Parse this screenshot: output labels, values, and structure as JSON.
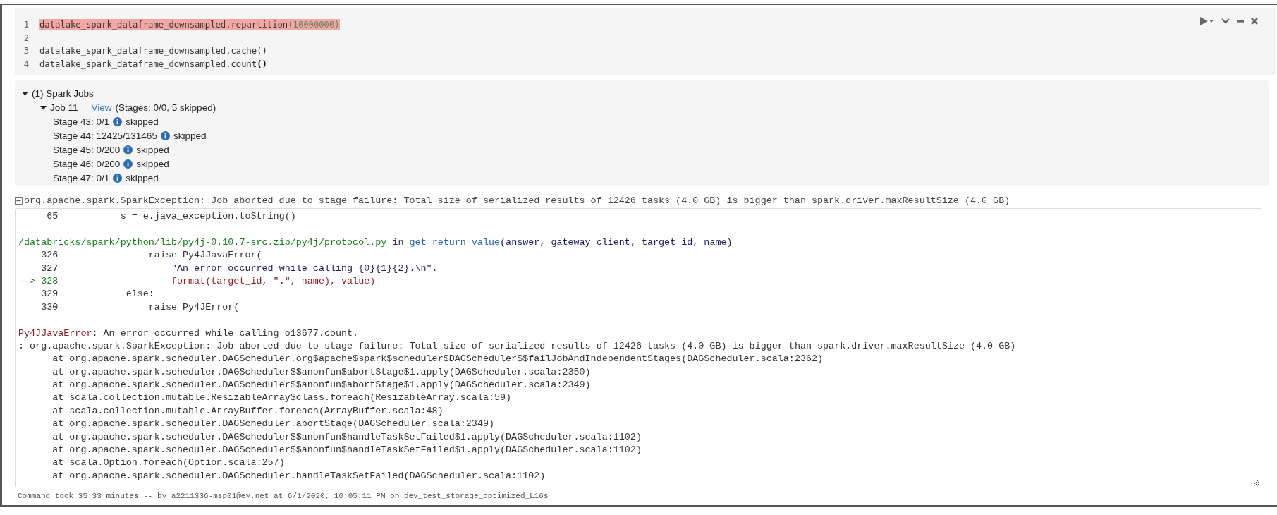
{
  "code_lines": [
    {
      "number": "1",
      "highlighted": true,
      "segments": [
        {
          "kind": "plain",
          "text": "datalake_spark_dataframe_downsampled.repartition"
        },
        {
          "kind": "number",
          "text": "(10000000)"
        }
      ]
    },
    {
      "number": "2",
      "highlighted": false
    },
    {
      "number": "3",
      "highlighted": false,
      "segments": [
        {
          "kind": "plain",
          "text": "datalake_spark_dataframe_downsampled.cache()"
        }
      ]
    },
    {
      "number": "4",
      "highlighted": false,
      "segments": [
        {
          "kind": "plain",
          "text": "datalake_spark_dataframe_downsampled.count"
        },
        {
          "kind": "bold",
          "text": "()"
        }
      ]
    }
  ],
  "spark_jobs": {
    "title": "(1) Spark Jobs",
    "expanded": true,
    "jobs": [
      {
        "label": "Job 11",
        "expanded": true,
        "link": "View",
        "summary": "(Stages: 0/0, 5 skipped)",
        "stages": [
          {
            "label": "Stage 43: 0/1",
            "status": "skipped"
          },
          {
            "label": "Stage 44: 12425/131465",
            "status": "skipped"
          },
          {
            "label": "Stage 45: 0/200",
            "status": "skipped"
          },
          {
            "label": "Stage 46: 0/200",
            "status": "skipped"
          },
          {
            "label": "Stage 47: 0/1",
            "status": "skipped"
          }
        ]
      }
    ]
  },
  "error_header": {
    "expanded": true,
    "text": "org.apache.spark.SparkException: Job aborted due to stage failure: Total size of serialized results of 12426 tasks (4.0 GB) is bigger than spark.driver.maxResultSize (4.0 GB)"
  },
  "traceback": [
    {
      "kind": "source",
      "number": "65",
      "segments": [
        {
          "kind": "plain",
          "text": "           s = e.java_exception.toString()"
        }
      ]
    },
    {
      "kind": "blank"
    },
    {
      "kind": "location",
      "segments": [
        {
          "kind": "path",
          "text": "/databricks/spark/python/lib/py4j-0.10.7-src.zip/py4j/protocol.py"
        },
        {
          "kind": "plain",
          "text": " in "
        },
        {
          "kind": "func",
          "text": "get_return_value"
        },
        {
          "kind": "args",
          "text": "(answer, gateway_client, target_id, name)"
        }
      ]
    },
    {
      "kind": "source",
      "number": "326",
      "segments": [
        {
          "kind": "plain",
          "text": "                raise Py4JJavaError("
        }
      ]
    },
    {
      "kind": "source",
      "number": "327",
      "segments": [
        {
          "kind": "string",
          "text": "                    \"An error occurred while calling {0}{1}{2}.\\n\"."
        }
      ]
    },
    {
      "kind": "current",
      "marker": "-->",
      "number": "328",
      "segments": [
        {
          "kind": "error",
          "text": "                    format(target_id, \".\", name), value)"
        }
      ]
    },
    {
      "kind": "source",
      "number": "329",
      "segments": [
        {
          "kind": "plain",
          "text": "            else:"
        }
      ]
    },
    {
      "kind": "source",
      "number": "330",
      "segments": [
        {
          "kind": "plain",
          "text": "                raise Py4JError("
        }
      ]
    },
    {
      "kind": "blank"
    },
    {
      "kind": "text",
      "segments": [
        {
          "kind": "error",
          "text": "Py4JJavaError"
        },
        {
          "kind": "plain",
          "text": ": An error occurred while calling o13677.count."
        }
      ]
    },
    {
      "kind": "text",
      "segments": [
        {
          "kind": "plain",
          "text": ": org.apache.spark.SparkException: Job aborted due to stage failure: Total size of serialized results of 12426 tasks (4.0 GB) is bigger than spark.driver.maxResultSize (4.0 GB)"
        }
      ]
    },
    {
      "kind": "text",
      "segments": [
        {
          "kind": "plain",
          "text": "\tat org.apache.spark.scheduler.DAGScheduler.org$apache$spark$scheduler$DAGScheduler$$failJobAndIndependentStages(DAGScheduler.scala:2362)"
        }
      ]
    },
    {
      "kind": "text",
      "segments": [
        {
          "kind": "plain",
          "text": "\tat org.apache.spark.scheduler.DAGScheduler$$anonfun$abortStage$1.apply(DAGScheduler.scala:2350)"
        }
      ]
    },
    {
      "kind": "text",
      "segments": [
        {
          "kind": "plain",
          "text": "\tat org.apache.spark.scheduler.DAGScheduler$$anonfun$abortStage$1.apply(DAGScheduler.scala:2349)"
        }
      ]
    },
    {
      "kind": "text",
      "segments": [
        {
          "kind": "plain",
          "text": "\tat scala.collection.mutable.ResizableArray$class.foreach(ResizableArray.scala:59)"
        }
      ]
    },
    {
      "kind": "text",
      "segments": [
        {
          "kind": "plain",
          "text": "\tat scala.collection.mutable.ArrayBuffer.foreach(ArrayBuffer.scala:48)"
        }
      ]
    },
    {
      "kind": "text",
      "segments": [
        {
          "kind": "plain",
          "text": "\tat org.apache.spark.scheduler.DAGScheduler.abortStage(DAGScheduler.scala:2349)"
        }
      ]
    },
    {
      "kind": "text",
      "segments": [
        {
          "kind": "plain",
          "text": "\tat org.apache.spark.scheduler.DAGScheduler$$anonfun$handleTaskSetFailed$1.apply(DAGScheduler.scala:1102)"
        }
      ]
    },
    {
      "kind": "text",
      "segments": [
        {
          "kind": "plain",
          "text": "\tat org.apache.spark.scheduler.DAGScheduler$$anonfun$handleTaskSetFailed$1.apply(DAGScheduler.scala:1102)"
        }
      ]
    },
    {
      "kind": "text",
      "segments": [
        {
          "kind": "plain",
          "text": "\tat scala.Option.foreach(Option.scala:257)"
        }
      ]
    },
    {
      "kind": "text",
      "segments": [
        {
          "kind": "plain",
          "text": "\tat org.apache.spark.scheduler.DAGScheduler.handleTaskSetFailed(DAGScheduler.scala:1102)"
        }
      ]
    }
  ],
  "footer": "Command took 35.33 minutes -- by a2211336-msp01@ey.net at 6/1/2020, 10:05:11 PM on dev_test_storage_optimized_L16s"
}
